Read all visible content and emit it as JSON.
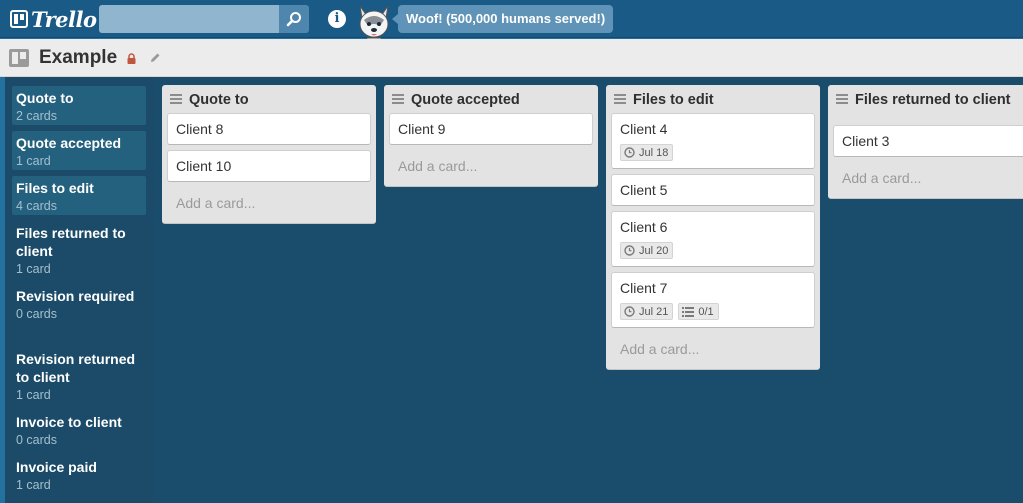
{
  "header": {
    "logo_text": "Trello",
    "search": {
      "value": "",
      "placeholder": ""
    },
    "mascot_message": "Woof! (500,000 humans served!)"
  },
  "board": {
    "title": "Example"
  },
  "sidebar": {
    "items": [
      {
        "name": "Quote to",
        "count": "2 cards"
      },
      {
        "name": "Quote accepted",
        "count": "1 card"
      },
      {
        "name": "Files to edit",
        "count": "4 cards"
      },
      {
        "name": "Files returned to client",
        "count": "1 card"
      },
      {
        "name": "Revision required",
        "count": "0 cards"
      },
      {
        "name": "Revision returned to client",
        "count": "1 card"
      },
      {
        "name": "Invoice to client",
        "count": "0 cards"
      },
      {
        "name": "Invoice paid",
        "count": "1 card"
      }
    ]
  },
  "lists": [
    {
      "title": "Quote to",
      "cards": [
        {
          "title": "Client 8"
        },
        {
          "title": "Client 10"
        }
      ],
      "add_card": "Add a card..."
    },
    {
      "title": "Quote accepted",
      "cards": [
        {
          "title": "Client 9"
        }
      ],
      "add_card": "Add a card..."
    },
    {
      "title": "Files to edit",
      "cards": [
        {
          "title": "Client 4",
          "due": "Jul 18"
        },
        {
          "title": "Client 5"
        },
        {
          "title": "Client 6",
          "due": "Jul 20"
        },
        {
          "title": "Client 7",
          "due": "Jul 21",
          "checklist": "0/1"
        }
      ],
      "add_card": "Add a card..."
    },
    {
      "title": "Files returned to client",
      "cards": [
        {
          "title": "Client 3"
        }
      ],
      "add_card": "Add a card..."
    }
  ],
  "colors": {
    "header_bg": "#1a5a86",
    "board_bg": "#194d6b",
    "sidebar_bg": "#1b4b68",
    "sidebar_active": "#24617f",
    "list_bg": "#e3e3e3"
  },
  "icons": {
    "search": "search-icon",
    "info": "info-icon",
    "lock": "lock-icon",
    "edit": "pencil-icon",
    "due": "clock-icon",
    "checklist": "checklist-icon",
    "list_menu": "list-menu-icon"
  }
}
